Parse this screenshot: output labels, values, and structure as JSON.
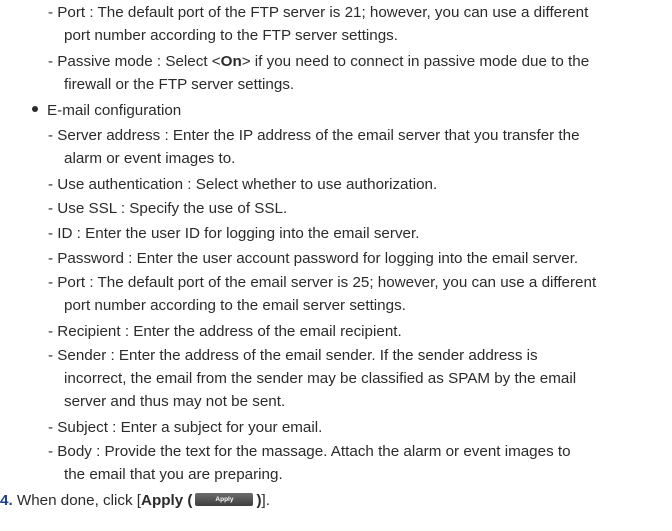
{
  "ftp": {
    "port_line1": "- Port : The default port of the FTP server is 21; however, you can use a different",
    "port_line2": "port number according to the FTP server settings.",
    "passive_pre": "- Passive mode : Select <",
    "passive_bold": "On",
    "passive_post": "> if you need to connect in passive mode due to the",
    "passive_line2": "firewall or the FTP server settings."
  },
  "email": {
    "heading": "E-mail configuration",
    "server_line1": "- Server address : Enter the IP address of the email server that you transfer the",
    "server_line2": "alarm or event images to.",
    "auth": "- Use authentication : Select whether to use authorization.",
    "ssl": "- Use SSL : Specify the use of SSL.",
    "id": "- ID : Enter the user ID for logging into the email server.",
    "password": "- Password : Enter the user account password for logging into the email server.",
    "port_line1": "- Port : The default port of the email server is 25; however, you can use a different",
    "port_line2": "port number according to the email server settings.",
    "recipient": "- Recipient : Enter the address of the email recipient.",
    "sender_line1": "- Sender : Enter the address of the email sender. If the sender address is",
    "sender_line2": "incorrect, the email from the sender may be classified as SPAM by the email",
    "sender_line3": "server and thus may not be sent.",
    "subject": "- Subject : Enter a subject for your email.",
    "body_line1": "- Body : Provide the text for the massage. Attach the alarm or event images to",
    "body_line2": "the email that you are preparing."
  },
  "step4": {
    "number": "4.",
    "text": " When done, click [",
    "apply_bold": "Apply (",
    "apply_button": "Apply",
    "apply_close_bold": ")",
    "end": "]."
  }
}
